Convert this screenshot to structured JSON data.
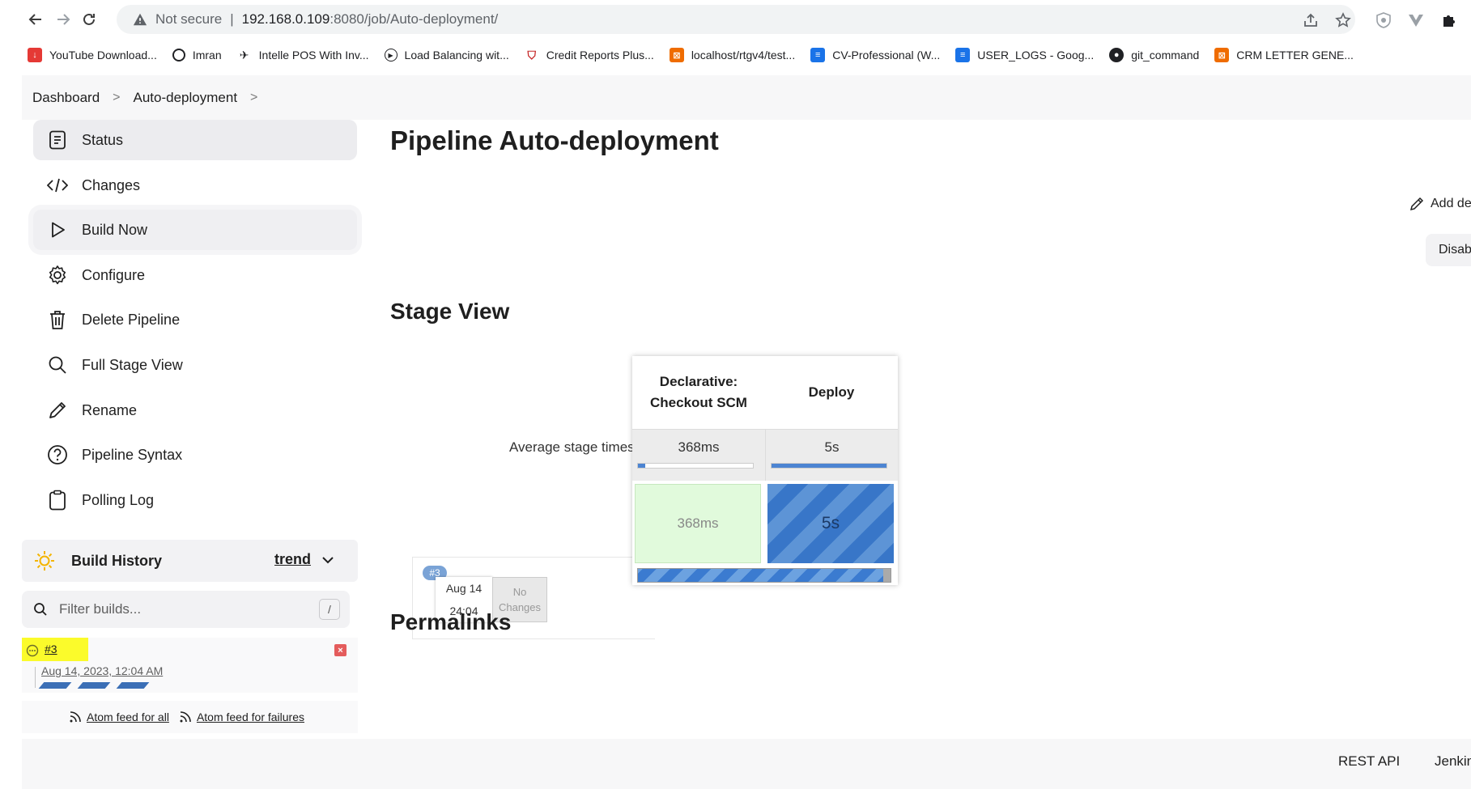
{
  "browser": {
    "security_label": "Not secure",
    "url_host": "192.168.0.109",
    "url_path": ":8080/job/Auto-deployment/",
    "bookmarks": [
      {
        "label": "YouTube Download...",
        "color": "#e53935"
      },
      {
        "label": "Imran",
        "color": "#202124"
      },
      {
        "label": "Intelle POS With Inv...",
        "color": "#202124"
      },
      {
        "label": "Load Balancing wit...",
        "color": "#202124"
      },
      {
        "label": "Credit Reports Plus...",
        "color": "#c62828"
      },
      {
        "label": "localhost/rtgv4/test...",
        "color": "#ef6c00"
      },
      {
        "label": "CV-Professional (W...",
        "color": "#1a73e8"
      },
      {
        "label": "USER_LOGS - Goog...",
        "color": "#1a73e8"
      },
      {
        "label": "git_command",
        "color": "#202124"
      },
      {
        "label": "CRM LETTER GENE...",
        "color": "#ef6c00"
      }
    ]
  },
  "breadcrumb": {
    "items": [
      "Dashboard",
      "Auto-deployment"
    ]
  },
  "sidebar": {
    "items": [
      {
        "label": "Status",
        "icon": "status-icon"
      },
      {
        "label": "Changes",
        "icon": "code-icon"
      },
      {
        "label": "Build Now",
        "icon": "play-icon"
      },
      {
        "label": "Configure",
        "icon": "gear-icon"
      },
      {
        "label": "Delete Pipeline",
        "icon": "trash-icon"
      },
      {
        "label": "Full Stage View",
        "icon": "search-icon"
      },
      {
        "label": "Rename",
        "icon": "pencil-icon"
      },
      {
        "label": "Pipeline Syntax",
        "icon": "help-icon"
      },
      {
        "label": "Polling Log",
        "icon": "clipboard-icon"
      }
    ]
  },
  "build_history": {
    "title": "Build History",
    "trend_label": "trend",
    "filter_placeholder": "Filter builds...",
    "filter_shortcut": "/",
    "builds": [
      {
        "number": "#3",
        "date": "Aug 14, 2023, 12:04 AM"
      }
    ],
    "feed_all": "Atom feed for all",
    "feed_failures": "Atom feed for failures"
  },
  "main": {
    "title": "Pipeline Auto-deployment",
    "add_description": "Add descr",
    "disable_button": "Disable P",
    "stage_view_title": "Stage View",
    "permalinks_title": "Permalinks"
  },
  "stage_view": {
    "average_label": "Average stage times:",
    "stages": [
      {
        "name_line1": "Declarative:",
        "name_line2": "Checkout SCM",
        "avg": "368ms",
        "avg_fill": 0.06
      },
      {
        "name_line1": "Deploy",
        "name_line2": "",
        "avg": "5s",
        "avg_fill": 1.0
      }
    ],
    "run": {
      "badge": "#3",
      "date": "Aug 14",
      "time": "24:04",
      "changes": "No Changes",
      "cells": [
        "368ms",
        "5s"
      ],
      "progress": 0.97
    }
  },
  "footer": {
    "rest_api": "REST API",
    "jenkins": "Jenkins"
  }
}
